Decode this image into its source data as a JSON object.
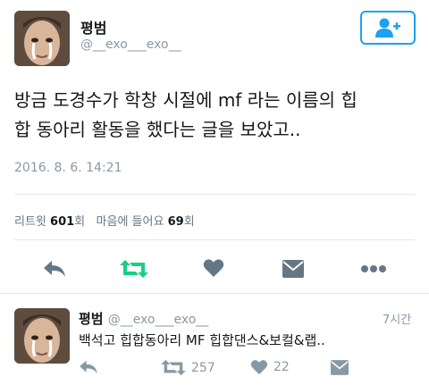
{
  "main_tweet": {
    "author_name": "평범",
    "author_handle": "@__exo___exo__",
    "text_line1": "방금 도경수가 학창 시절에 mf 라는 이름의 힙",
    "text_line2": "합 동아리 활동을 했다는 글을 보았고..",
    "timestamp": "2016. 8. 6. 14:21",
    "stats": {
      "retweets_label": "리트윗",
      "retweets_count": "601",
      "retweets_unit": "회",
      "likes_label": "마음에 들어요",
      "likes_count": "69",
      "likes_unit": "회"
    }
  },
  "icons": {
    "follow": "add-user-icon",
    "reply": "reply-icon",
    "retweet": "retweet-icon",
    "like": "heart-icon",
    "message": "envelope-icon",
    "more": "more-dots-icon"
  },
  "colors": {
    "accent": "#1da1f2",
    "retweet_active": "#19cf86",
    "muted": "#8899a6",
    "icon_gray": "#657786"
  },
  "reply_tweet": {
    "author_name": "평범",
    "author_handle": "@__exo___exo__",
    "time": "7시간",
    "text": "백석고 힙합동아리 MF 힙합댄스&보컬&랩..",
    "retweet_count": "257",
    "like_count": "22"
  }
}
